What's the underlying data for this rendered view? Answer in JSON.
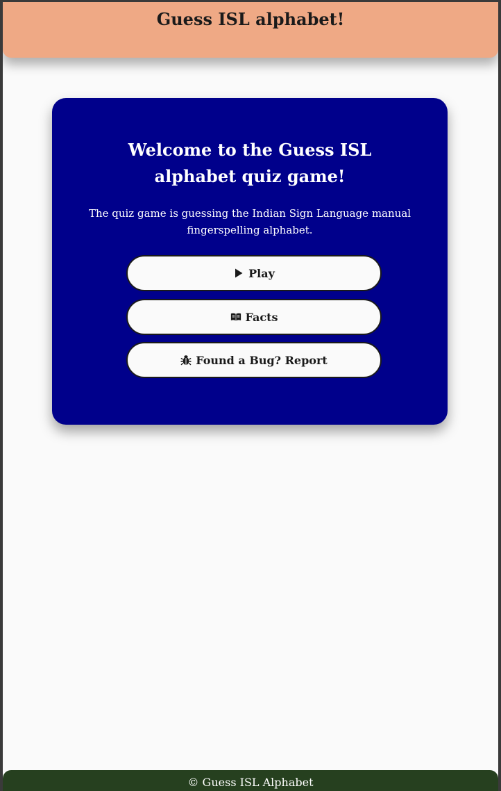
{
  "header": {
    "title": "Guess ISL alphabet!"
  },
  "card": {
    "heading": "Welcome to the Guess ISL alphabet quiz game!",
    "description": "The quiz game is guessing the Indian Sign Language manual fingerspelling alphabet.",
    "buttons": [
      {
        "label": "Play",
        "icon": "play-icon"
      },
      {
        "label": "Facts",
        "icon": "book-open-icon"
      },
      {
        "label": "Found a Bug? Report",
        "icon": "bug-icon"
      }
    ]
  },
  "footer": {
    "text": "© Guess ISL Alphabet"
  },
  "colors": {
    "header_bg": "#efa985",
    "card_bg": "#00008b",
    "footer_bg": "#26401f",
    "page_bg": "#fafafa",
    "button_bg": "#fafafa",
    "text_dark": "#1a1a1a"
  }
}
